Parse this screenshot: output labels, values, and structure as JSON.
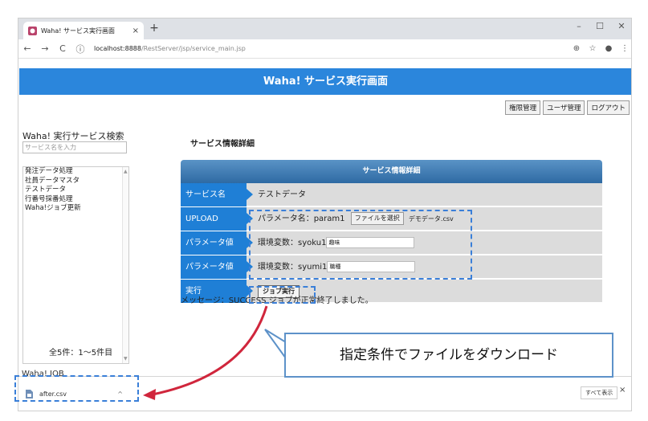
{
  "browser": {
    "tab_title": "Waha! サービス実行画面",
    "tab_close": "×",
    "new_tab": "+",
    "win_min": "–",
    "win_max": "☐",
    "win_close": "✕",
    "nav_back": "←",
    "nav_forward": "→",
    "nav_reload": "C",
    "secure": "ⓘ",
    "url_host": "localhost:8888",
    "url_path": "/RestServer/jsp/service_main.jsp",
    "tool_zoom": "⊕",
    "tool_star": "☆",
    "tool_account": "●",
    "tool_menu": "⋮"
  },
  "header": {
    "title": "Waha! サービス実行画面",
    "buttons": [
      "権限管理",
      "ユーザ管理",
      "ログアウト"
    ]
  },
  "left_pane": {
    "title": "Waha! 実行サービス検索",
    "search_placeholder": "サービス名を入力",
    "items": [
      "発注データ処理",
      "社員データマスタ",
      "テストデータ",
      "行番号採番処理",
      "Waha!ジョブ更新"
    ],
    "scroll_up": "▲",
    "scroll_down": "▼",
    "count": "全5件：1～5件目",
    "job_section": "Waha! JOB"
  },
  "detail": {
    "page_heading": "サービス情報詳細",
    "panel_heading": "サービス情報詳細",
    "rows": [
      {
        "label": "サービス名",
        "value": "テストデータ"
      },
      {
        "label": "UPLOAD",
        "value": "パラメータ名：param1",
        "button": "ファイルを選択",
        "file": "デモデータ.csv"
      },
      {
        "label": "パラメータ値",
        "value": "環境変数：syoku1",
        "input": "趣味"
      },
      {
        "label": "パラメータ値",
        "value": "環境変数：syumi1",
        "input": "職種"
      },
      {
        "label": "実行",
        "button": "ジョブ実行"
      }
    ],
    "message": "メッセージ：SUCCESS ジョブが正常終了しました。"
  },
  "downloads": {
    "file": "after.csv",
    "chevron": "^",
    "show_all": "すべて表示",
    "close": "×"
  },
  "annotation": {
    "callout_text": "指定条件でファイルをダウンロード",
    "accent": "#3a7fd8",
    "arrow_color": "#d0263c"
  }
}
